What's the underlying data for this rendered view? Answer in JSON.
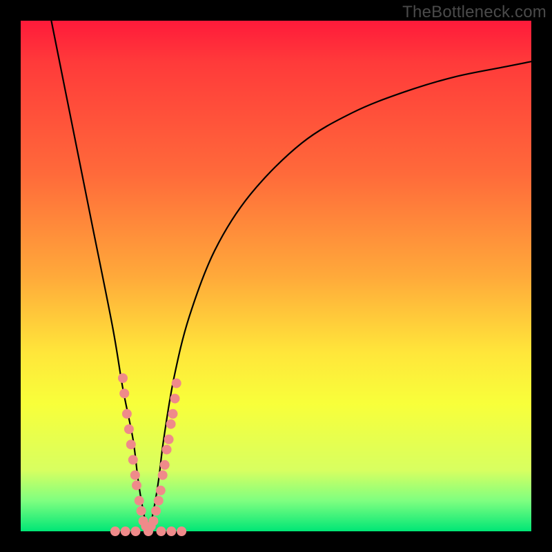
{
  "watermark": "TheBottleneck.com",
  "colors": {
    "frame": "#000000",
    "curve": "#000000",
    "marker": "#ef8a8a",
    "gradient_stops": [
      "#ff1a3a",
      "#ff3a3a",
      "#ff6a3a",
      "#ffa93a",
      "#ffe63a",
      "#f8ff3a",
      "#d8ff60",
      "#7fff80",
      "#00e676"
    ]
  },
  "chart_data": {
    "type": "line",
    "title": "",
    "xlabel": "",
    "ylabel": "",
    "xlim": [
      0,
      100
    ],
    "ylim": [
      0,
      100
    ],
    "note": "V-shaped bottleneck curve; y-axis inverted visually (0 at bottom = good/green, 100 at top = bad/red). Minimum of curve sits near x≈25, y≈0.",
    "series": [
      {
        "name": "bottleneck-curve",
        "x": [
          6,
          10,
          14,
          18,
          20,
          22,
          23,
          24,
          25,
          26,
          27,
          28,
          30,
          33,
          38,
          45,
          55,
          65,
          75,
          85,
          95,
          100
        ],
        "y": [
          100,
          80,
          60,
          40,
          28,
          18,
          10,
          4,
          0,
          4,
          10,
          18,
          30,
          42,
          55,
          66,
          76,
          82,
          86,
          89,
          91,
          92
        ]
      }
    ],
    "markers": {
      "name": "highlight-points",
      "note": "Salmon dots clustered along both arms of the V near the bottom and a horizontal row along the trough.",
      "points": [
        {
          "x": 20.0,
          "y": 30
        },
        {
          "x": 20.3,
          "y": 27
        },
        {
          "x": 20.8,
          "y": 23
        },
        {
          "x": 21.2,
          "y": 20
        },
        {
          "x": 21.6,
          "y": 17
        },
        {
          "x": 22.0,
          "y": 14
        },
        {
          "x": 22.4,
          "y": 11
        },
        {
          "x": 22.7,
          "y": 9
        },
        {
          "x": 23.2,
          "y": 6
        },
        {
          "x": 23.6,
          "y": 4
        },
        {
          "x": 24.0,
          "y": 2
        },
        {
          "x": 24.5,
          "y": 1
        },
        {
          "x": 25.0,
          "y": 0
        },
        {
          "x": 25.5,
          "y": 1
        },
        {
          "x": 26.0,
          "y": 2
        },
        {
          "x": 26.5,
          "y": 4
        },
        {
          "x": 27.0,
          "y": 6
        },
        {
          "x": 27.4,
          "y": 8
        },
        {
          "x": 27.8,
          "y": 11
        },
        {
          "x": 28.2,
          "y": 13
        },
        {
          "x": 28.6,
          "y": 16
        },
        {
          "x": 29.0,
          "y": 18
        },
        {
          "x": 29.4,
          "y": 21
        },
        {
          "x": 29.8,
          "y": 23
        },
        {
          "x": 30.2,
          "y": 26
        },
        {
          "x": 30.5,
          "y": 29
        },
        {
          "x": 18.5,
          "y": 0
        },
        {
          "x": 20.5,
          "y": 0
        },
        {
          "x": 22.5,
          "y": 0
        },
        {
          "x": 27.5,
          "y": 0
        },
        {
          "x": 29.5,
          "y": 0
        },
        {
          "x": 31.5,
          "y": 0
        }
      ]
    }
  }
}
